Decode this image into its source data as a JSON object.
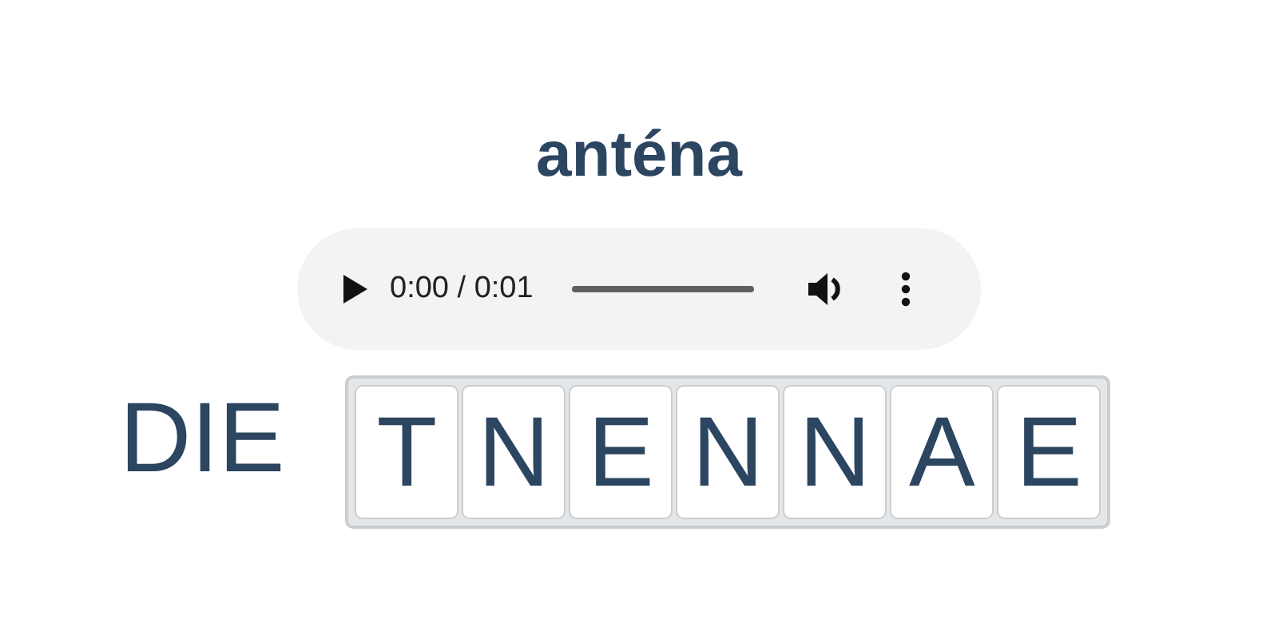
{
  "word": "anténa",
  "player": {
    "time": "0:00 / 0:01"
  },
  "article": "DIE",
  "tiles": [
    {
      "letter": "T"
    },
    {
      "letter": "N"
    },
    {
      "letter": "E"
    },
    {
      "letter": "N"
    },
    {
      "letter": "N"
    },
    {
      "letter": "A"
    },
    {
      "letter": "E"
    }
  ]
}
